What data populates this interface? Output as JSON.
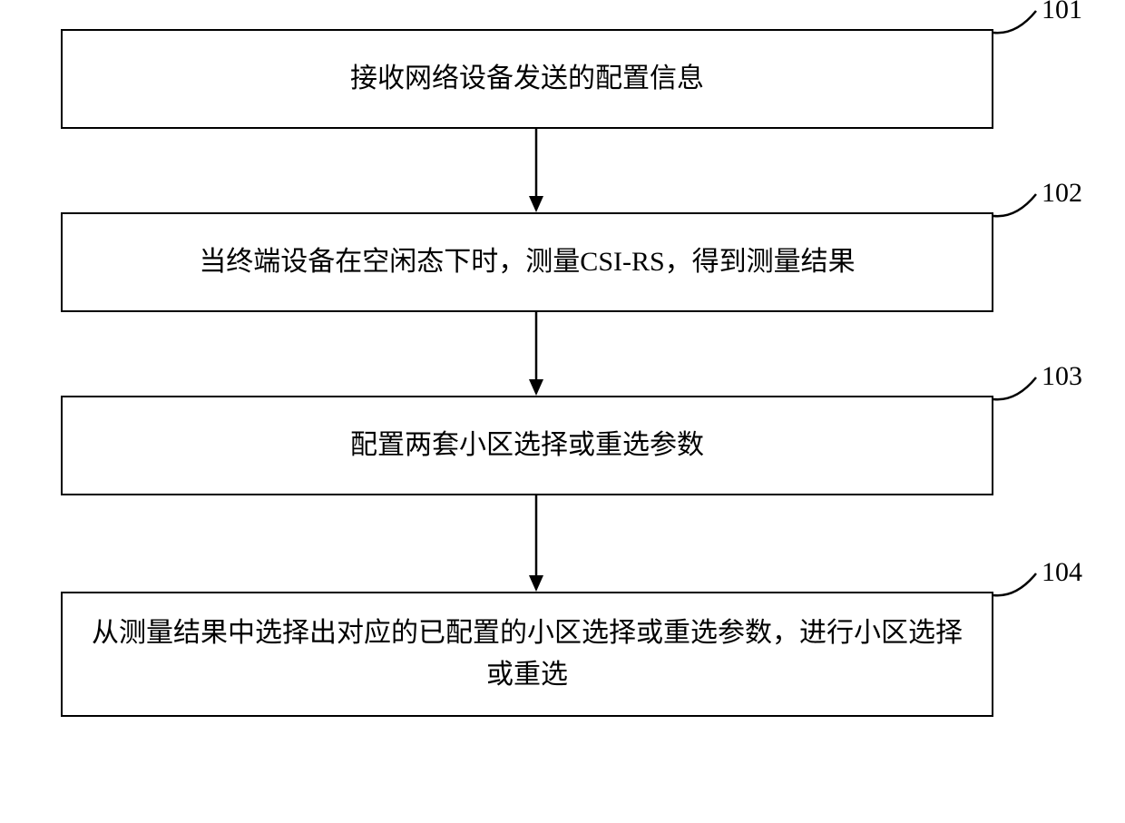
{
  "steps": [
    {
      "num": "101",
      "text": "接收网络设备发送的配置信息"
    },
    {
      "num": "102",
      "text": "当终端设备在空闲态下时，测量CSI-RS，得到测量结果"
    },
    {
      "num": "103",
      "text": "配置两套小区选择或重选参数"
    },
    {
      "num": "104",
      "text": "从测量结果中选择出对应的已配置的小区选择或重选参数，进行小区选择或重选"
    }
  ]
}
